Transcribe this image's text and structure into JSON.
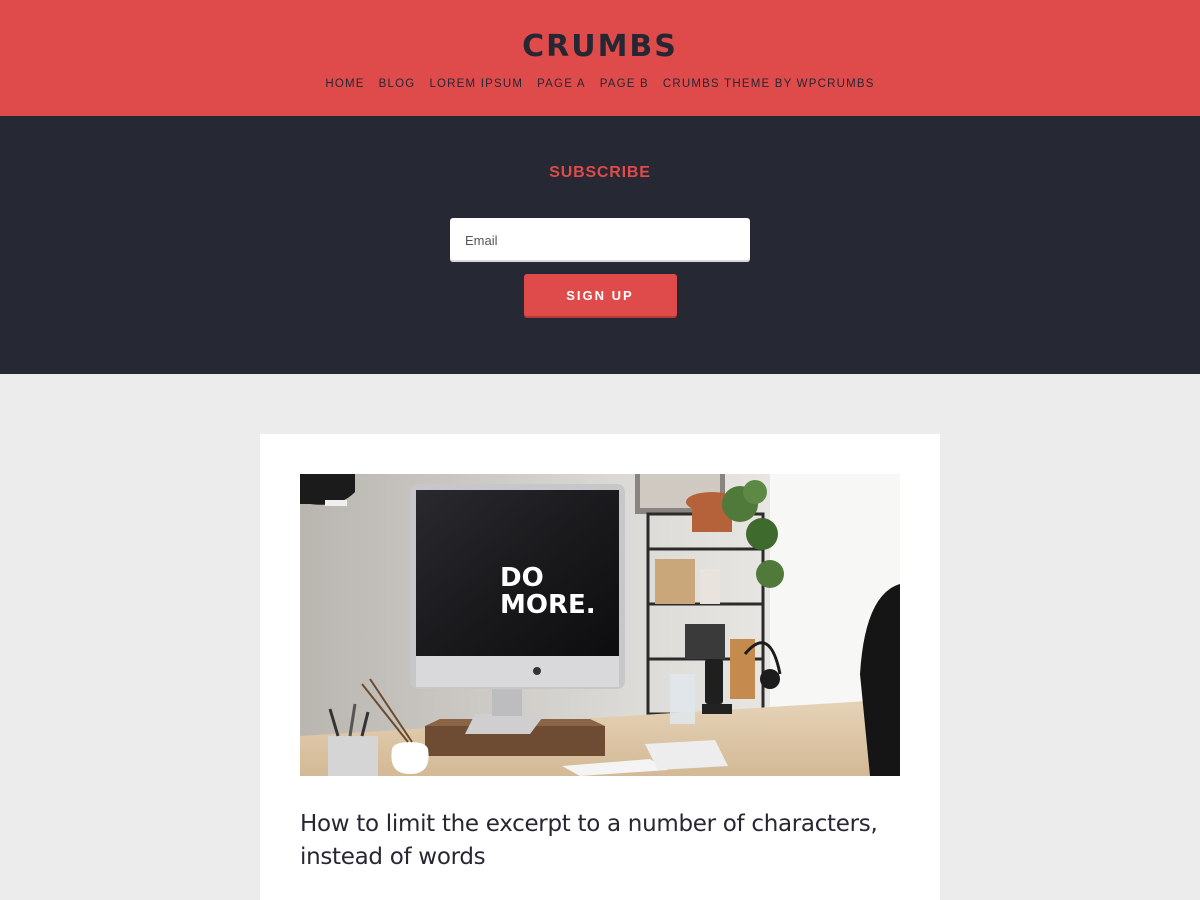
{
  "header": {
    "site_title": "CRUMBS",
    "nav": [
      {
        "label": "HOME"
      },
      {
        "label": "BLOG"
      },
      {
        "label": "LOREM IPSUM"
      },
      {
        "label": "PAGE A"
      },
      {
        "label": "PAGE B"
      },
      {
        "label": "CRUMBS THEME BY WPCRUMBS"
      }
    ]
  },
  "subscribe": {
    "title": "SUBSCRIBE",
    "email_placeholder": "Email",
    "button_label": "SIGN UP"
  },
  "post": {
    "image_text_line1": "DO",
    "image_text_line2": "MORE.",
    "title": "How to limit the excerpt to a number of characters, instead of words"
  },
  "colors": {
    "accent": "#df4b4a",
    "dark": "#262833",
    "page_bg": "#ececec"
  }
}
